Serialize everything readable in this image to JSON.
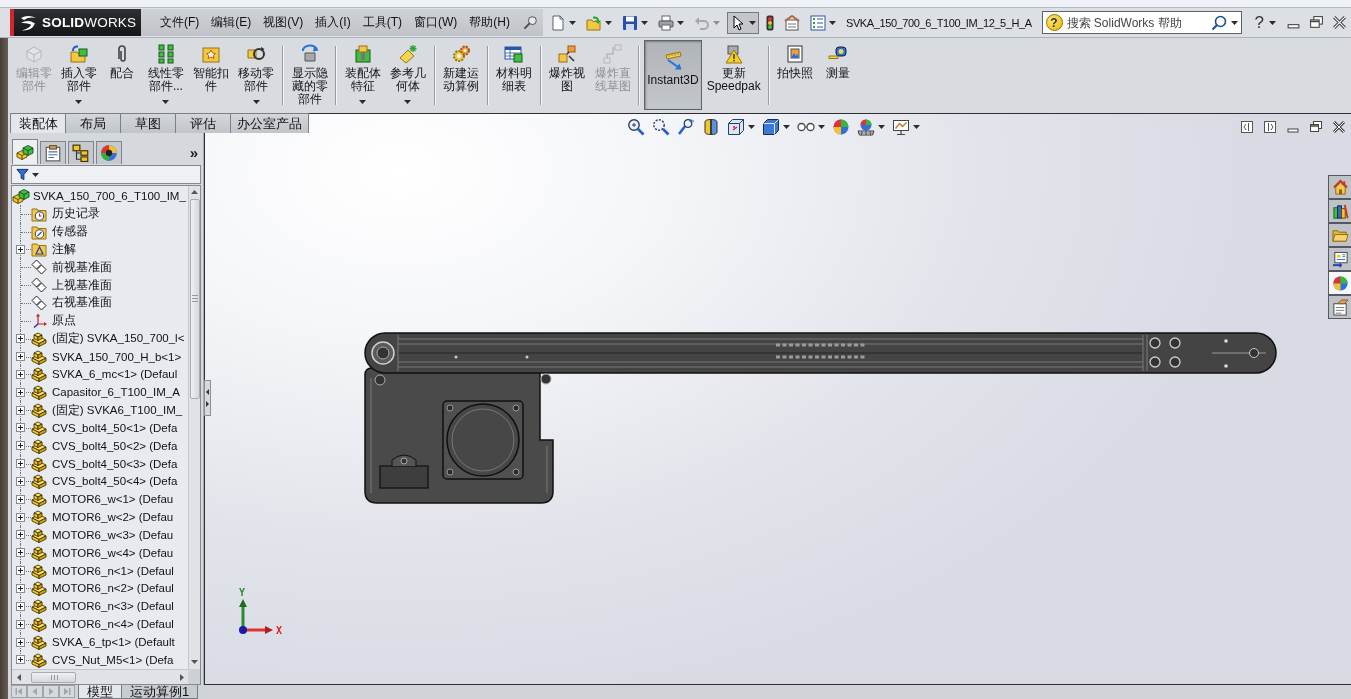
{
  "logo": {
    "text": "**SOLID**WORKS"
  },
  "menu": [
    "文件(F)",
    "编辑(E)",
    "视图(V)",
    "插入(I)",
    "工具(T)",
    "窗口(W)",
    "帮助(H)"
  ],
  "quick_access": [
    {
      "kind": "new",
      "dropdown": true,
      "disabled": false,
      "pressed": false
    },
    {
      "kind": "open",
      "dropdown": true,
      "disabled": false,
      "pressed": false
    },
    {
      "kind": "save",
      "dropdown": true,
      "disabled": false,
      "pressed": false
    },
    {
      "kind": "print",
      "dropdown": true,
      "disabled": false,
      "pressed": false
    },
    {
      "kind": "undo",
      "dropdown": true,
      "disabled": true,
      "pressed": false
    },
    {
      "kind": "select",
      "dropdown": true,
      "disabled": false,
      "pressed": true
    },
    {
      "kind": "rebuild",
      "dropdown": false,
      "disabled": false,
      "pressed": false
    },
    {
      "kind": "file-properties",
      "dropdown": false,
      "disabled": false,
      "pressed": false
    },
    {
      "kind": "options",
      "dropdown": true,
      "disabled": false,
      "pressed": false
    }
  ],
  "document_title": "SVKA_150_700_6_T100_IM_12_5_H_A",
  "search": {
    "badge": "?",
    "placeholder": "搜索 SolidWorks 帮助"
  },
  "help_button": {
    "label": "?"
  },
  "command_manager": {
    "groups": [
      {
        "buttons": [
          {
            "label": "编辑零部件",
            "kind": "edit-component",
            "dropdown": false,
            "disabled": true,
            "pressed": false
          },
          {
            "label": "插入零部件",
            "kind": "insert-component",
            "dropdown": true,
            "disabled": false,
            "pressed": false
          },
          {
            "label": "配合",
            "kind": "mate",
            "dropdown": false,
            "disabled": false,
            "pressed": false
          },
          {
            "label": "线性零部件...",
            "kind": "linear-pattern",
            "dropdown": true,
            "disabled": false,
            "pressed": false
          },
          {
            "label": "智能扣件",
            "kind": "smart-fasteners",
            "dropdown": false,
            "disabled": false,
            "pressed": false
          },
          {
            "label": "移动零部件",
            "kind": "move-component",
            "dropdown": true,
            "disabled": false,
            "pressed": false
          }
        ]
      },
      {
        "buttons": [
          {
            "label": "显示隐藏的零部件",
            "kind": "show-hidden",
            "dropdown": false,
            "disabled": false,
            "pressed": false
          }
        ]
      },
      {
        "buttons": [
          {
            "label": "装配体特征",
            "kind": "assembly-features",
            "dropdown": true,
            "disabled": false,
            "pressed": false
          },
          {
            "label": "参考几何体",
            "kind": "reference-geometry",
            "dropdown": true,
            "disabled": false,
            "pressed": false
          }
        ]
      },
      {
        "buttons": [
          {
            "label": "新建运动算例",
            "kind": "new-motion-study",
            "dropdown": false,
            "disabled": false,
            "pressed": false
          }
        ]
      },
      {
        "buttons": [
          {
            "label": "材料明细表",
            "kind": "bill-of-materials",
            "dropdown": false,
            "disabled": false,
            "pressed": false
          }
        ]
      },
      {
        "buttons": [
          {
            "label": "爆炸视图",
            "kind": "exploded-view",
            "dropdown": false,
            "disabled": false,
            "pressed": false
          },
          {
            "label": "爆炸直线草图",
            "kind": "explode-line-sketch",
            "dropdown": false,
            "disabled": true,
            "pressed": false
          }
        ]
      },
      {
        "buttons": [
          {
            "label": "Instant3D",
            "kind": "instant3d",
            "dropdown": false,
            "disabled": false,
            "pressed": true
          },
          {
            "label": "更新 Speedpak",
            "kind": "update-speedpak",
            "dropdown": false,
            "disabled": false,
            "pressed": false
          }
        ]
      },
      {
        "buttons": [
          {
            "label": "拍快照",
            "kind": "take-snapshot",
            "dropdown": false,
            "disabled": false,
            "pressed": false
          },
          {
            "label": "测量",
            "kind": "measure",
            "dropdown": false,
            "disabled": false,
            "pressed": false
          }
        ]
      }
    ]
  },
  "command_tabs": [
    {
      "label": "装配体",
      "selected": true
    },
    {
      "label": "布局",
      "selected": false
    },
    {
      "label": "草图",
      "selected": false
    },
    {
      "label": "评估",
      "selected": false
    },
    {
      "label": "办公室产品",
      "selected": false
    }
  ],
  "feature_manager": {
    "tabs": [
      {
        "kind": "feature-tree",
        "selected": true
      },
      {
        "kind": "property-manager",
        "selected": false
      },
      {
        "kind": "configuration-manager",
        "selected": false
      },
      {
        "kind": "display-manager",
        "selected": false
      }
    ],
    "more": "»",
    "tree": [
      {
        "label": "SVKA_150_700_6_T100_IM_",
        "kind": "assembly",
        "children": [
          {
            "label": "历史记录",
            "kind": "history"
          },
          {
            "label": "传感器",
            "kind": "sensors"
          },
          {
            "label": "注解",
            "kind": "annotations",
            "expanded": false
          },
          {
            "label": "前视基准面",
            "kind": "plane"
          },
          {
            "label": "上视基准面",
            "kind": "plane"
          },
          {
            "label": "右视基准面",
            "kind": "plane"
          },
          {
            "label": "原点",
            "kind": "origin"
          },
          {
            "label": "(固定) SVKA_150_700_l<",
            "kind": "part",
            "expanded": false
          },
          {
            "label": "SVKA_150_700_H_b<1>",
            "kind": "part",
            "expanded": false
          },
          {
            "label": "SVKA_6_mc<1> (Defaul",
            "kind": "part",
            "expanded": false
          },
          {
            "label": "Capasitor_6_T100_IM_A",
            "kind": "part",
            "expanded": false
          },
          {
            "label": "(固定) SVKA6_T100_IM_",
            "kind": "part",
            "expanded": false
          },
          {
            "label": "CVS_bolt4_50<1> (Defa",
            "kind": "part",
            "expanded": false
          },
          {
            "label": "CVS_bolt4_50<2> (Defa",
            "kind": "part",
            "expanded": false
          },
          {
            "label": "CVS_bolt4_50<3> (Defa",
            "kind": "part",
            "expanded": false
          },
          {
            "label": "CVS_bolt4_50<4> (Defa",
            "kind": "part",
            "expanded": false
          },
          {
            "label": "MOTOR6_w<1> (Defau",
            "kind": "part",
            "expanded": false
          },
          {
            "label": "MOTOR6_w<2> (Defau",
            "kind": "part",
            "expanded": false
          },
          {
            "label": "MOTOR6_w<3> (Defau",
            "kind": "part",
            "expanded": false
          },
          {
            "label": "MOTOR6_w<4> (Defau",
            "kind": "part",
            "expanded": false
          },
          {
            "label": "MOTOR6_n<1> (Defaul",
            "kind": "part",
            "expanded": false
          },
          {
            "label": "MOTOR6_n<2> (Defaul",
            "kind": "part",
            "expanded": false
          },
          {
            "label": "MOTOR6_n<3> (Defaul",
            "kind": "part",
            "expanded": false
          },
          {
            "label": "MOTOR6_n<4> (Defaul",
            "kind": "part",
            "expanded": false
          },
          {
            "label": "SVKA_6_tp<1> (Default",
            "kind": "part",
            "expanded": false
          },
          {
            "label": "CVS_Nut_M5<1> (Defa",
            "kind": "part",
            "expanded": false
          }
        ]
      }
    ]
  },
  "view_toolbar": [
    {
      "kind": "zoom-to-fit",
      "dropdown": false
    },
    {
      "kind": "zoom-to-area",
      "dropdown": false
    },
    {
      "kind": "previous-view",
      "dropdown": false
    },
    {
      "kind": "section-view",
      "dropdown": false
    },
    {
      "kind": "view-orientation",
      "dropdown": true
    },
    {
      "kind": "display-style",
      "dropdown": true
    },
    {
      "kind": "hide-show",
      "dropdown": true
    },
    {
      "kind": "edit-appearance",
      "dropdown": false
    },
    {
      "kind": "apply-scene",
      "dropdown": true
    },
    {
      "kind": "view-settings",
      "dropdown": true
    }
  ],
  "task_pane": [
    {
      "kind": "home",
      "selected": false
    },
    {
      "kind": "design-library",
      "selected": false
    },
    {
      "kind": "file-explorer",
      "selected": false
    },
    {
      "kind": "view-palette",
      "selected": false
    },
    {
      "kind": "appearances",
      "selected": true
    },
    {
      "kind": "custom-properties",
      "selected": false
    }
  ],
  "triad": {
    "y_label": "Y",
    "x_label": "X"
  },
  "bottom_nav": [
    {
      "kind": "first",
      "disabled": true
    },
    {
      "kind": "previous",
      "disabled": true
    },
    {
      "kind": "next",
      "disabled": true
    },
    {
      "kind": "last",
      "disabled": true
    }
  ],
  "bottom_tabs": [
    {
      "label": "模型",
      "selected": true
    },
    {
      "label": "运动算例1",
      "selected": false
    }
  ]
}
